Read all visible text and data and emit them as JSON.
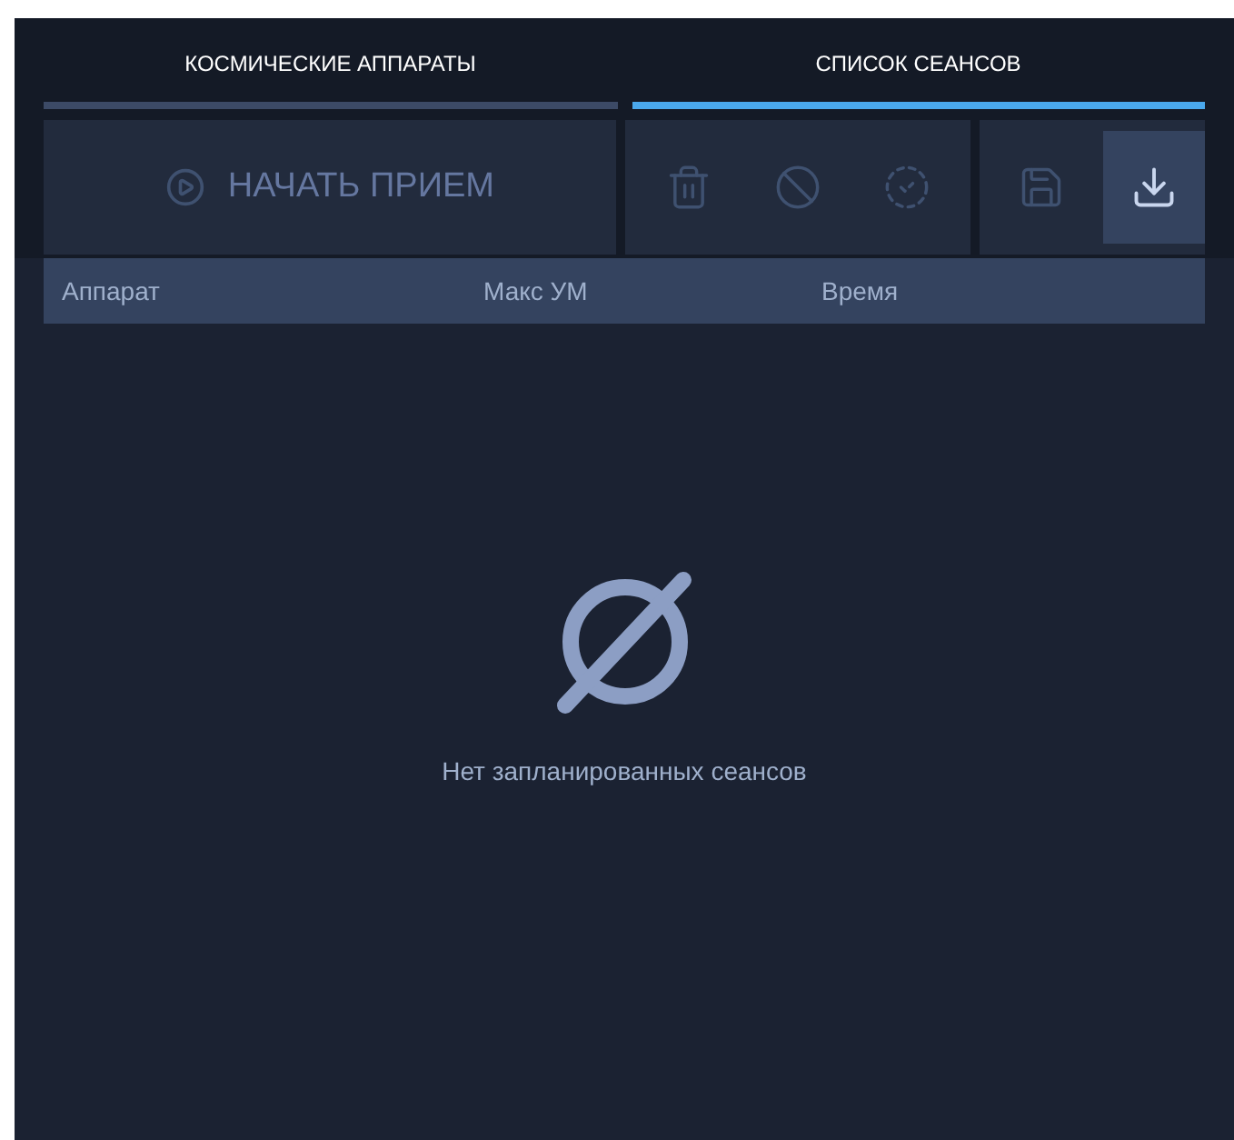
{
  "tabs": [
    {
      "label": "КОСМИЧЕСКИЕ АППАРАТЫ",
      "selected": false
    },
    {
      "label": "СПИСОК СЕАНСОВ",
      "selected": true
    }
  ],
  "toolbar": {
    "start_button": {
      "label": "НАЧАТЬ ПРИЕМ",
      "disabled": true
    },
    "actions": [
      {
        "kind": "delete",
        "disabled": true,
        "active": false
      },
      {
        "kind": "cancel",
        "disabled": true,
        "active": false
      },
      {
        "kind": "confirm",
        "disabled": true,
        "active": false
      }
    ],
    "file_actions": [
      {
        "kind": "save",
        "disabled": true,
        "active": false
      },
      {
        "kind": "import",
        "disabled": false,
        "active": true
      }
    ]
  },
  "table": {
    "columns": [
      "Аппарат",
      "Макс УМ",
      "Время"
    ]
  },
  "empty_state": {
    "message": "Нет запланированных сеансов"
  }
}
